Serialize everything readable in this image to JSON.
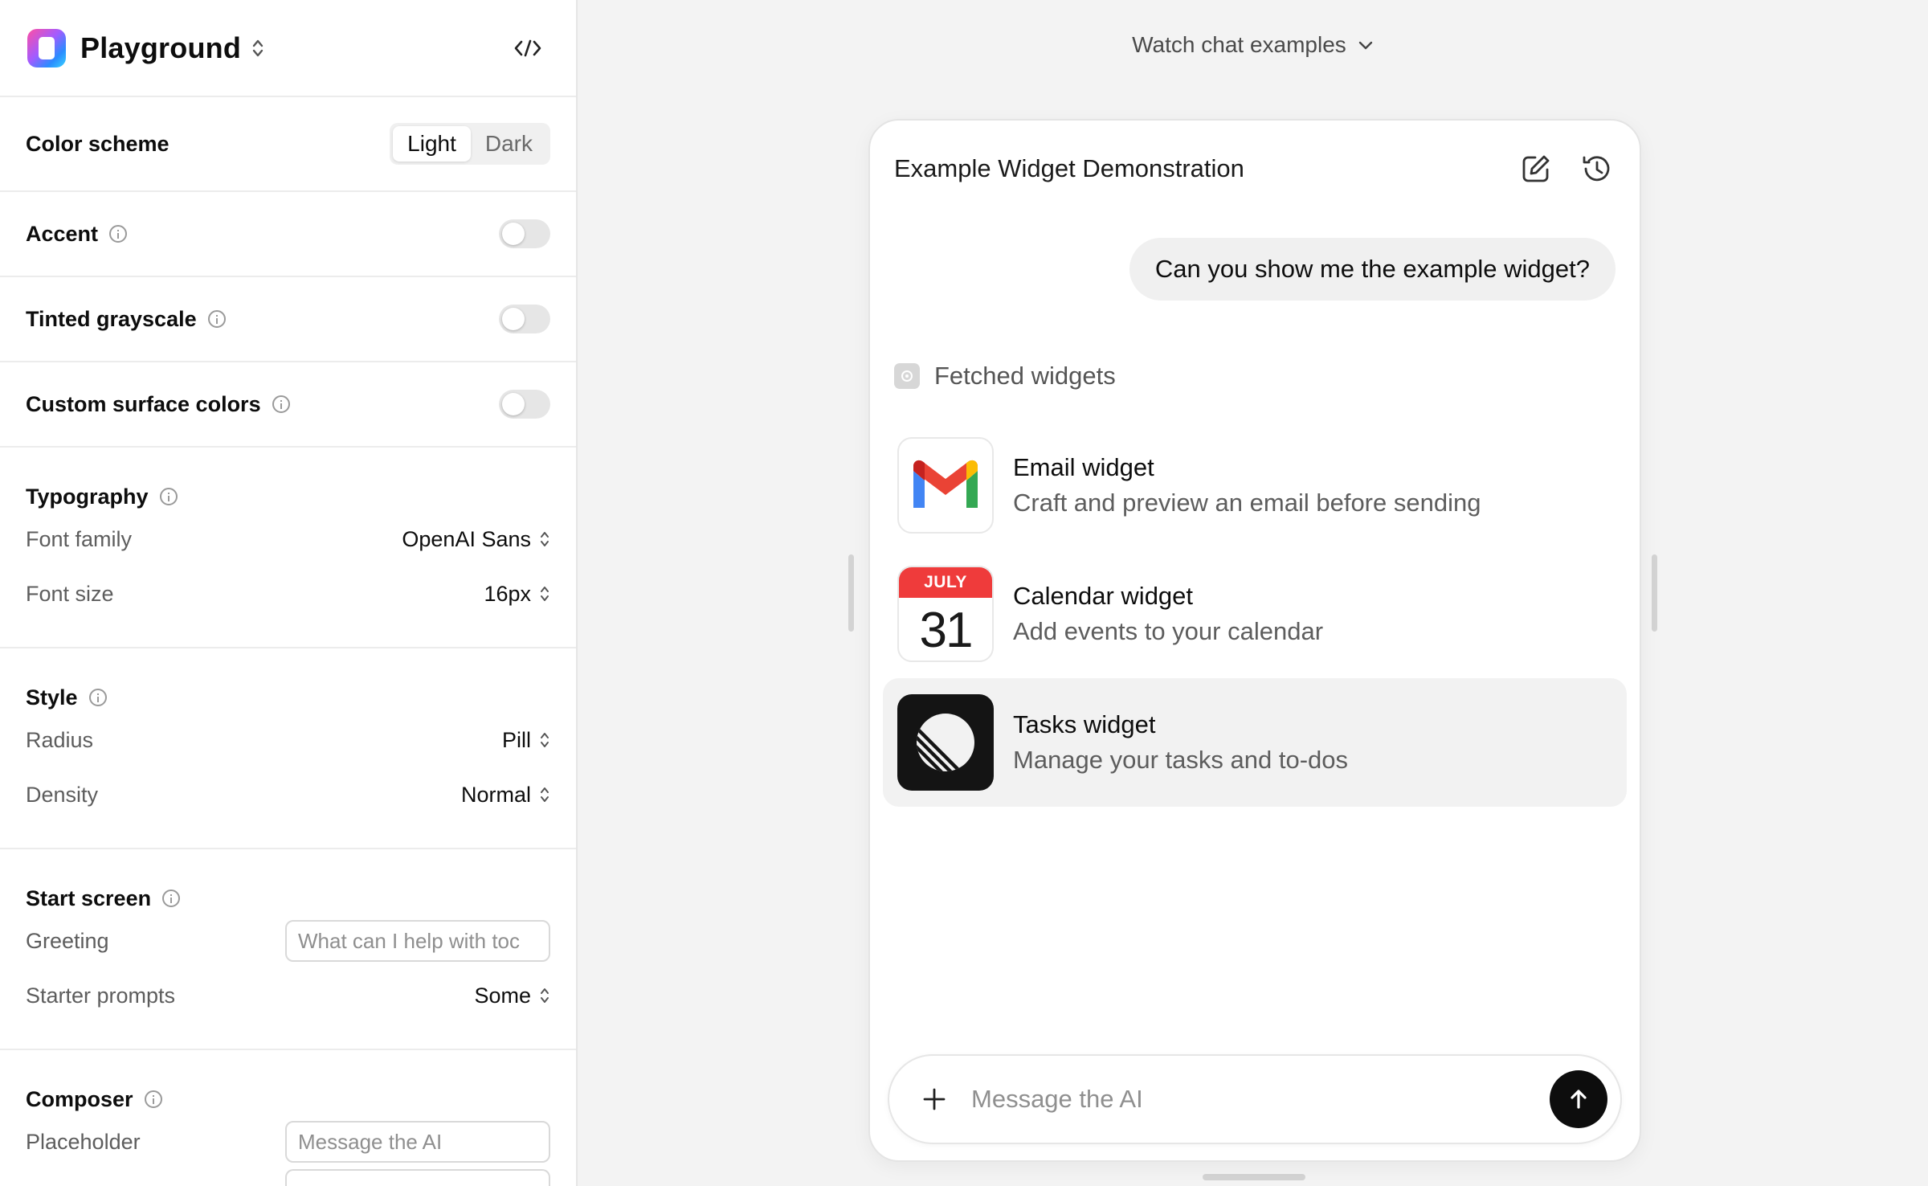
{
  "sidebar": {
    "app_title": "Playground",
    "color_scheme": {
      "label": "Color scheme",
      "options": [
        "Light",
        "Dark"
      ],
      "selected": "Light"
    },
    "accent": {
      "label": "Accent",
      "enabled": false
    },
    "tinted_grayscale": {
      "label": "Tinted grayscale",
      "enabled": false
    },
    "custom_surface_colors": {
      "label": "Custom surface colors",
      "enabled": false
    },
    "typography": {
      "label": "Typography",
      "font_family": {
        "label": "Font family",
        "value": "OpenAI Sans"
      },
      "font_size": {
        "label": "Font size",
        "value": "16px"
      }
    },
    "style": {
      "label": "Style",
      "radius": {
        "label": "Radius",
        "value": "Pill"
      },
      "density": {
        "label": "Density",
        "value": "Normal"
      }
    },
    "start_screen": {
      "label": "Start screen",
      "greeting": {
        "label": "Greeting",
        "placeholder": "What can I help with toc"
      },
      "starter_prompts": {
        "label": "Starter prompts",
        "value": "Some"
      }
    },
    "composer": {
      "label": "Composer",
      "placeholder": {
        "label": "Placeholder",
        "value": "Message the AI"
      }
    }
  },
  "main": {
    "watch_examples": "Watch chat examples",
    "chat": {
      "title": "Example Widget Demonstration",
      "user_message": "Can you show me the example widget?",
      "fetched_label": "Fetched widgets",
      "widgets": [
        {
          "title": "Email widget",
          "description": "Craft and preview an email before sending",
          "icon": "gmail-icon"
        },
        {
          "title": "Calendar widget",
          "description": "Add events to your calendar",
          "icon": "calendar-icon",
          "month": "JULY",
          "day": "31"
        },
        {
          "title": "Tasks widget",
          "description": "Manage your tasks and to-dos",
          "icon": "tasks-icon",
          "selected": true
        }
      ],
      "composer_placeholder": "Message the AI"
    }
  },
  "colors": {
    "calendar_red": "#ef3b3b",
    "gmail_red": "#ea4335",
    "gmail_blue": "#4285f4",
    "gmail_green": "#34a853",
    "gmail_yellow": "#fbbc04",
    "send_button": "#0d0d0d"
  }
}
